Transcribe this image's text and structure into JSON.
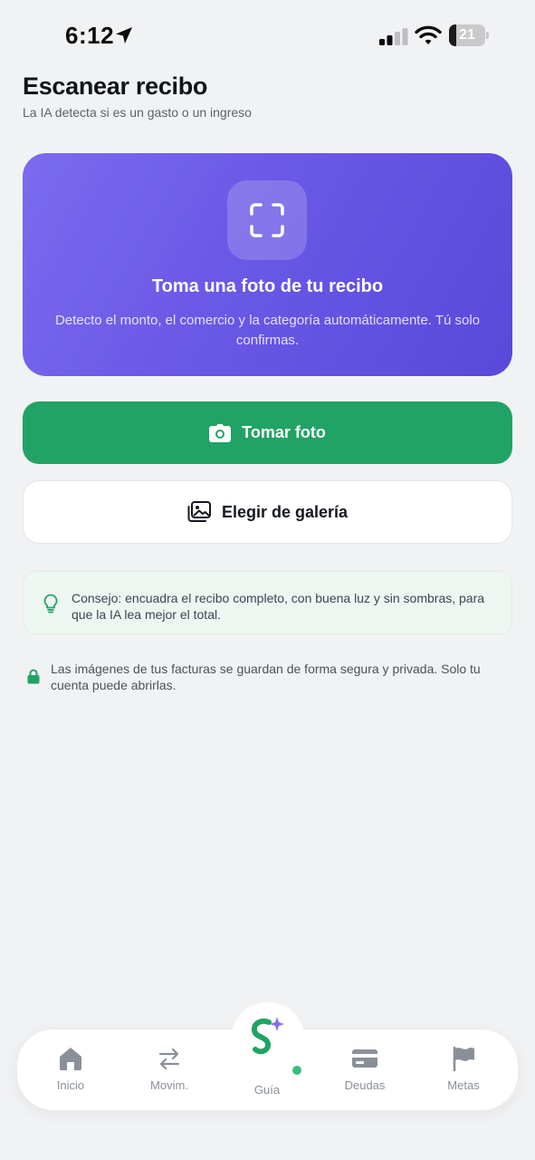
{
  "status_bar": {
    "time": "6:12",
    "battery_level": "21",
    "battery_fraction": 0.21
  },
  "header": {
    "title": "Escanear recibo",
    "subtitle": "La IA detecta si es un gasto o un ingreso"
  },
  "hero": {
    "icon": "scan-frame-icon",
    "title": "Toma una foto de tu recibo",
    "description": "Detecto el monto, el comercio y la categoría automáticamente. Tú solo confirmas."
  },
  "actions": {
    "take_photo_label": "Tomar foto",
    "take_photo_icon": "camera-icon",
    "gallery_label": "Elegir de galería",
    "gallery_icon": "image-gallery-icon"
  },
  "tip": {
    "icon": "lightbulb-icon",
    "text": "Consejo: encuadra el recibo completo, con buena luz y sin sombras, para que la IA lea mejor el total."
  },
  "privacy": {
    "icon": "lock-icon",
    "text": "Las imágenes de tus facturas se guardan de forma segura y privada. Solo tu cuenta puede abrirlas."
  },
  "nav": {
    "items": [
      {
        "label": "Inicio",
        "icon": "home-icon"
      },
      {
        "label": "Movim.",
        "icon": "transfer-arrows-icon"
      },
      {
        "label": "Guía",
        "icon": "app-logo-icon"
      },
      {
        "label": "Deudas",
        "icon": "credit-card-icon"
      },
      {
        "label": "Metas",
        "icon": "flag-icon"
      }
    ]
  },
  "colors": {
    "primary_green": "#21A366",
    "hero_purple": "#6A58E6",
    "background": "#F1F2F4",
    "sparkle_purple": "#8B6CF0"
  }
}
